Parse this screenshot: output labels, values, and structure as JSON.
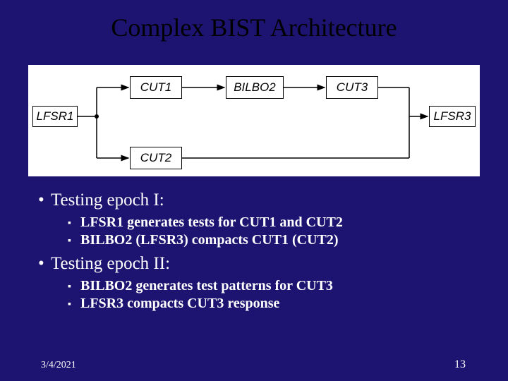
{
  "title": "Complex BIST Architecture",
  "blocks": {
    "lfsr1": "LFSR1",
    "cut1": "CUT1",
    "bilbo2": "BILBO2",
    "cut3": "CUT3",
    "lfsr3": "LFSR3",
    "cut2": "CUT2"
  },
  "bullets": {
    "epoch1": "Testing epoch I:",
    "epoch1_sub1": "LFSR1 generates tests for CUT1 and CUT2",
    "epoch1_sub2": "BILBO2 (LFSR3) compacts  CUT1 (CUT2)",
    "epoch2": "Testing epoch II:",
    "epoch2_sub1": "BILBO2 generates test patterns for CUT3",
    "epoch2_sub2": "LFSR3 compacts CUT3 response"
  },
  "footer": {
    "date": "3/4/2021",
    "page": "13"
  },
  "chart_data": {
    "type": "diagram",
    "nodes": [
      {
        "id": "LFSR1",
        "row": 1,
        "col": 0
      },
      {
        "id": "CUT1",
        "row": 0,
        "col": 1
      },
      {
        "id": "CUT2",
        "row": 2,
        "col": 1
      },
      {
        "id": "BILBO2",
        "row": 0,
        "col": 2
      },
      {
        "id": "CUT3",
        "row": 0,
        "col": 3
      },
      {
        "id": "LFSR3",
        "row": 1,
        "col": 4
      }
    ],
    "edges": [
      {
        "from": "LFSR1",
        "to": "CUT1"
      },
      {
        "from": "LFSR1",
        "to": "CUT2"
      },
      {
        "from": "CUT1",
        "to": "BILBO2"
      },
      {
        "from": "BILBO2",
        "to": "CUT3"
      },
      {
        "from": "CUT3",
        "to": "LFSR3"
      },
      {
        "from": "CUT2",
        "to": "LFSR3"
      }
    ]
  }
}
